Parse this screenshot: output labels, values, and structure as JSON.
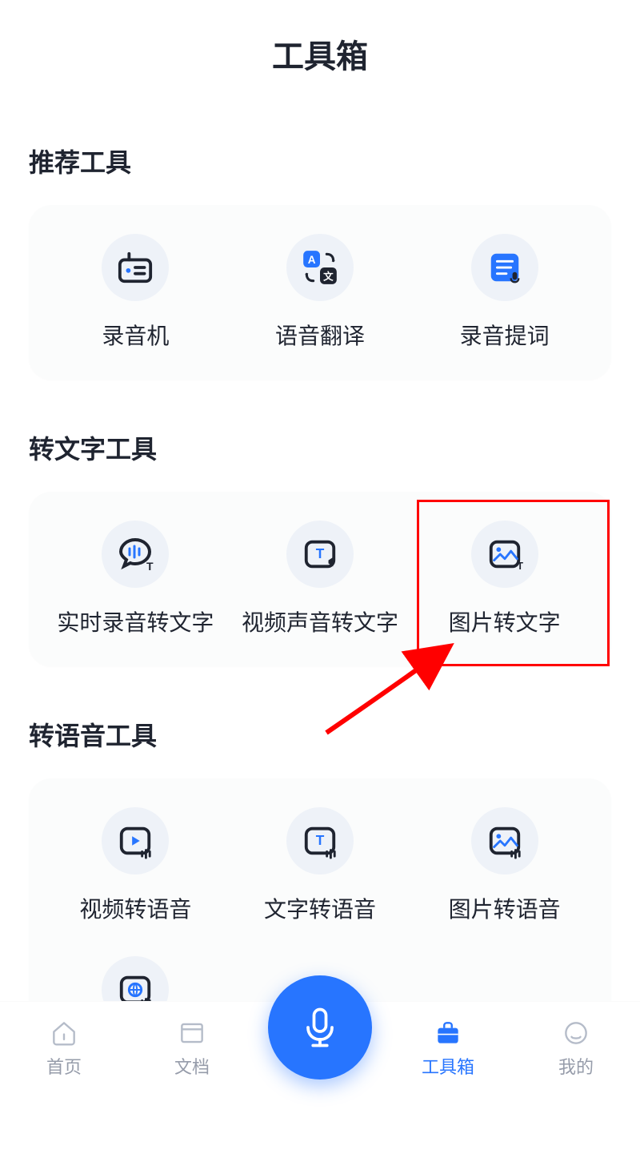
{
  "header": {
    "title": "工具箱"
  },
  "sections": {
    "recommended": {
      "title": "推荐工具",
      "tools": [
        {
          "label": "录音机"
        },
        {
          "label": "语音翻译"
        },
        {
          "label": "录音提词"
        }
      ]
    },
    "to_text": {
      "title": "转文字工具",
      "tools": [
        {
          "label": "实时录音转文字"
        },
        {
          "label": "视频声音转文字"
        },
        {
          "label": "图片转文字",
          "highlighted": true
        }
      ]
    },
    "to_voice": {
      "title": "转语音工具",
      "tools": [
        {
          "label": "视频转语音"
        },
        {
          "label": "文字转语音"
        },
        {
          "label": "图片转语音"
        },
        {
          "label": ""
        }
      ]
    }
  },
  "nav": {
    "items": [
      {
        "label": "首页"
      },
      {
        "label": "文档"
      },
      {
        "label": ""
      },
      {
        "label": "工具箱",
        "active": true
      },
      {
        "label": "我的"
      }
    ]
  }
}
